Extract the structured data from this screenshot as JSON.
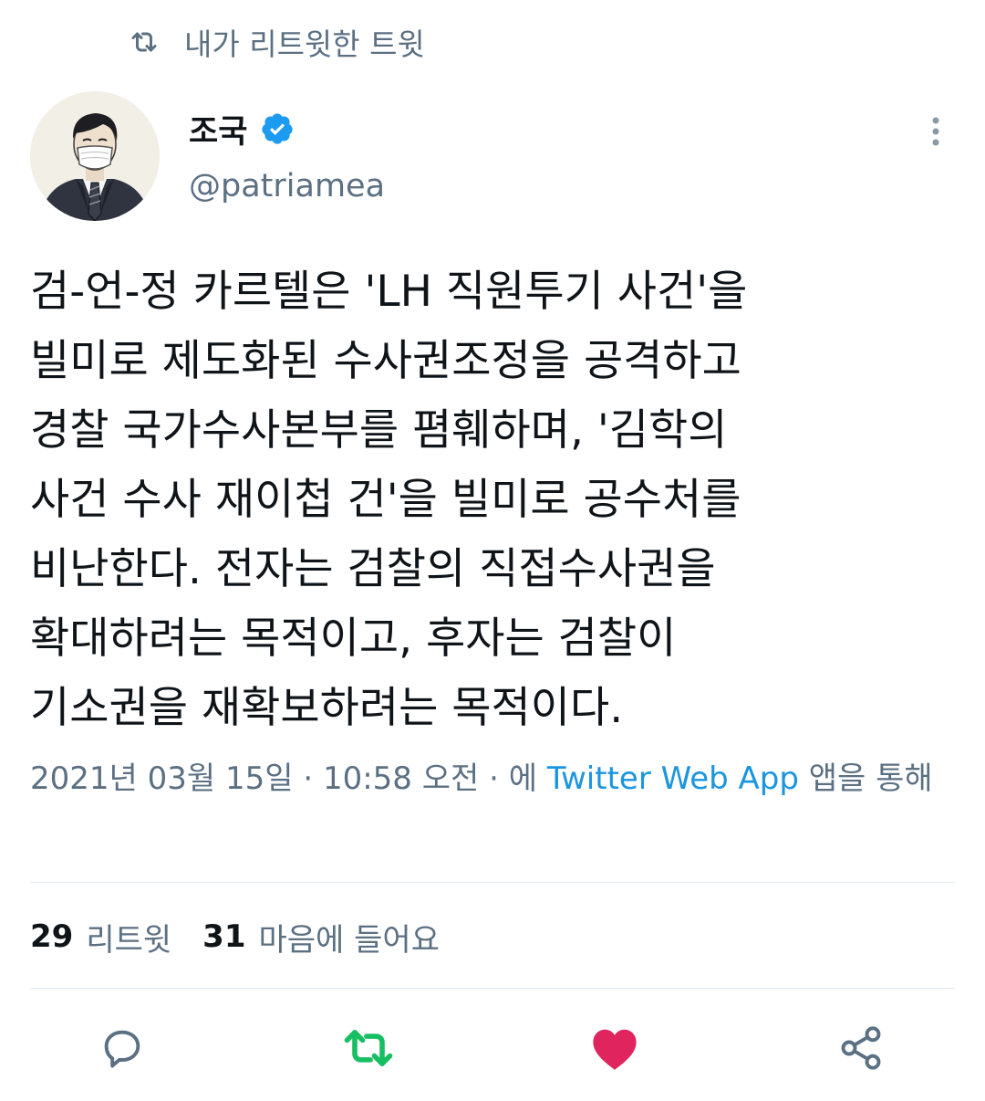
{
  "retweet_context": {
    "label": "내가 리트윗한 트윗",
    "icon": "retweet-icon"
  },
  "author": {
    "display_name": "조국",
    "handle": "@patriamea",
    "verified": true,
    "verified_icon": "verified-badge-icon"
  },
  "tweet": {
    "text": "검-언-정 카르텔은 'LH 직원투기 사건'을\n빌미로 제도화된 수사권조정을 공격하고\n경찰 국가수사본부를 폄훼하며, '김학의\n사건 수사 재이첩 건'을 빌미로 공수처를\n비난한다. 전자는 검찰의 직접수사권을\n확대하려는 목적이고, 후자는 검찰이\n기소권을 재확보하려는 목적이다."
  },
  "meta": {
    "date": "2021년 03월 15일",
    "separator": "·",
    "time": "10:58 오전",
    "via_prefix": "에",
    "source": "Twitter Web App",
    "via_suffix": "앱을 통해"
  },
  "stats": {
    "retweets_count": "29",
    "retweets_label": "리트윗",
    "likes_count": "31",
    "likes_label": "마음에 들어요"
  },
  "actions": {
    "reply_icon": "reply-icon",
    "retweet_icon": "retweet-icon",
    "like_icon": "heart-icon",
    "share_icon": "share-icon",
    "retweet_active": true,
    "like_active": true
  },
  "colors": {
    "accent": "#1b95e0",
    "secondary_text": "#5b7083",
    "retweet_active": "#17bf63",
    "like_active": "#e0245e",
    "divider": "#e1e8ed"
  }
}
